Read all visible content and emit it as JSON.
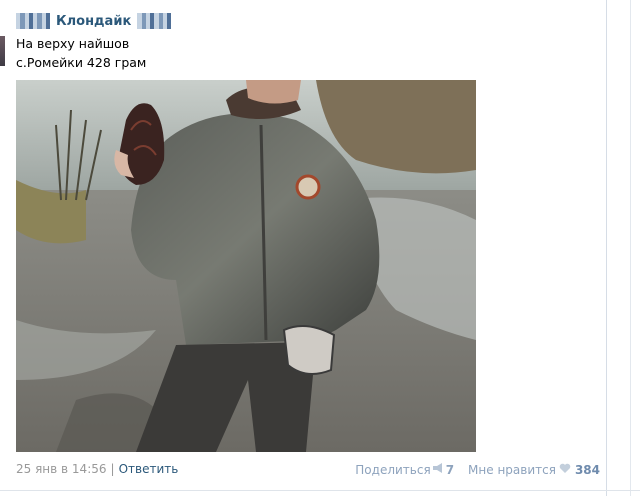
{
  "post": {
    "group_name": "Клондайк",
    "text_lines": [
      "На верху найшов",
      "с.Ромейки 428 грам"
    ],
    "date": "25 янв в 14:56",
    "separator": "|",
    "reply_label": "Ответить",
    "share_label": "Поделиться",
    "share_count": "7",
    "like_label": "Мне нравится",
    "like_count": "384"
  },
  "icons": {
    "share": "megaphone-icon",
    "like": "heart-icon",
    "group_logo": "mosaic-logo-icon"
  },
  "colors": {
    "link": "#2b587a",
    "muted": "#999999",
    "action": "#8ea3bd"
  }
}
